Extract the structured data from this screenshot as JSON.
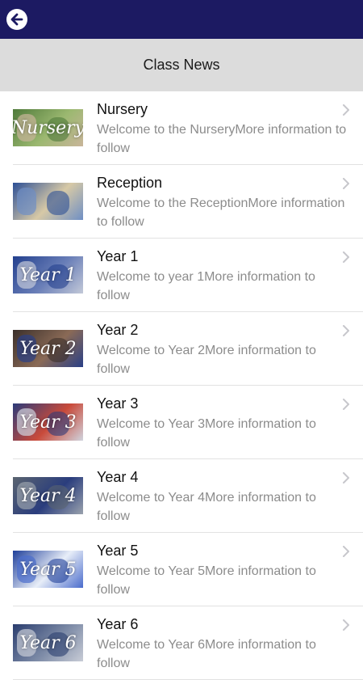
{
  "header": {
    "title": "Class News"
  },
  "items": [
    {
      "title": "Nursery",
      "description": "Welcome to the NurseryMore information to follow",
      "thumb_label": "Nursery",
      "thumb_colors": [
        "#4f7a3a",
        "#9bb870",
        "#c9b59a"
      ]
    },
    {
      "title": "Reception",
      "description": "Welcome to the ReceptionMore information to follow",
      "thumb_label": "",
      "thumb_colors": [
        "#2c4f96",
        "#d7c9a6",
        "#6f8fc4"
      ]
    },
    {
      "title": "Year 1",
      "description": "Welcome to year 1More information to follow",
      "thumb_label": "Year 1",
      "thumb_colors": [
        "#23408e",
        "#6a7fb8",
        "#c3c9d8"
      ]
    },
    {
      "title": "Year 2",
      "description": "Welcome to Year 2More information to follow",
      "thumb_label": "Year 2",
      "thumb_colors": [
        "#3a2f2a",
        "#8a6a56",
        "#2a3f86"
      ]
    },
    {
      "title": "Year 3",
      "description": "Welcome to Year 3More information to follow",
      "thumb_label": "Year 3",
      "thumb_colors": [
        "#2b3b7a",
        "#c94a3a",
        "#d0d4de"
      ]
    },
    {
      "title": "Year 4",
      "description": "Welcome to Year 4More information to follow",
      "thumb_label": "Year 4",
      "thumb_colors": [
        "#5a6470",
        "#2a3d7d",
        "#9aa2ad"
      ]
    },
    {
      "title": "Year 5",
      "description": "Welcome to Year 5More information to follow",
      "thumb_label": "Year 5",
      "thumb_colors": [
        "#1f3f9a",
        "#e8eef8",
        "#4a6ccc"
      ]
    },
    {
      "title": "Year 6",
      "description": "Welcome to Year 6More information to follow",
      "thumb_label": "Year 6",
      "thumb_colors": [
        "#2a3d6e",
        "#7c8aa6",
        "#c8ccd6"
      ]
    }
  ]
}
